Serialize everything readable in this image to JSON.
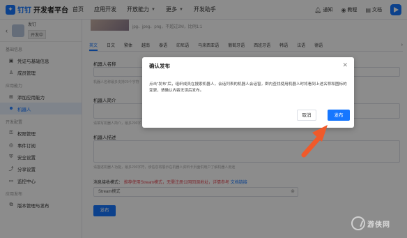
{
  "topbar": {
    "brand": "钉钉",
    "brand_sub": "开发者平台",
    "nav": [
      "首页",
      "应用开发",
      "开放能力",
      "更多",
      "开发助手"
    ],
    "right": {
      "notice": "通知",
      "tutorial": "教程",
      "docs": "文档"
    }
  },
  "sidebar": {
    "app_name": "发钉",
    "app_badge": "开发中",
    "groups": [
      {
        "title": "基础信息",
        "items": [
          {
            "label": "凭证与基础信息",
            "icon": "doc-icon"
          },
          {
            "label": "成员管理",
            "icon": "person-icon"
          }
        ]
      },
      {
        "title": "应用能力",
        "items": [
          {
            "label": "添加应用能力",
            "icon": "add-box-icon"
          },
          {
            "label": "机器人",
            "icon": "robot-icon",
            "active": true
          }
        ]
      },
      {
        "title": "开发配置",
        "items": [
          {
            "label": "权限管理",
            "icon": "key-icon"
          },
          {
            "label": "事件订阅",
            "icon": "bell-icon"
          },
          {
            "label": "安全设置",
            "icon": "shield-icon"
          },
          {
            "label": "分享设置",
            "icon": "share-icon"
          },
          {
            "label": "监控中心",
            "icon": "monitor-icon"
          }
        ]
      },
      {
        "title": "应用发布",
        "items": [
          {
            "label": "版本管理与发布",
            "icon": "version-icon"
          }
        ]
      }
    ]
  },
  "main": {
    "img_note": "jpg、jpeg、png，不超过2M，比例1:1",
    "lang_tabs": [
      "英文",
      "日文",
      "繁体",
      "越南",
      "泰语",
      "印尼语",
      "马来西亚语",
      "葡萄牙语",
      "西班牙语",
      "韩语",
      "法语",
      "德语"
    ],
    "lang_active": 0,
    "fields": {
      "name_label": "机器人名称",
      "name_hint": "机器人名称最多支持20个字符",
      "intro_label": "机器人简介",
      "intro_hint": "请填写机器人简介，最多200字",
      "desc_label": "机器人描述",
      "desc_hint": "请描述机器人功能，最多200字符，该信息将展示在机器人资料卡页面供用户了解机器人用途"
    },
    "stream": {
      "label": "消息接收模式：",
      "note": "推荐使用Stream模式，无需注册公网回调地址，详情参考",
      "link": "文档链接",
      "value": "Stream模式"
    },
    "publish_label": "发布"
  },
  "dialog": {
    "title": "确认发布",
    "body": "点击\"发布\"后，组织成员在搜索机器人，会话列表的机器人会话窗，群内查找使用机器人时将看到上述名称和图标的变更，请确认内容无误后发布。",
    "cancel": "取消",
    "confirm": "发布"
  },
  "watermark": "游侠网",
  "colors": {
    "primary": "#1677ff",
    "annotation_arrow": "#f05a2a"
  }
}
